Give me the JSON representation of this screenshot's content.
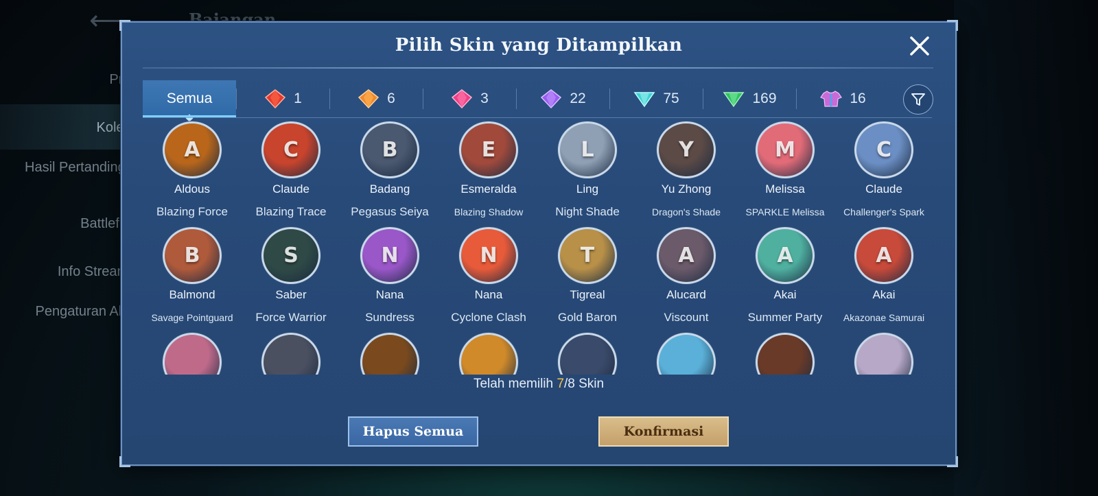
{
  "background": {
    "title": "Bajangan",
    "nav": [
      {
        "label": "Profil"
      },
      {
        "label": "Koleksi"
      },
      {
        "label": "Hasil Pertandingan"
      },
      {
        "label": "Battlefield"
      },
      {
        "label": "Info Streamer"
      },
      {
        "label": "Pengaturan Akun"
      }
    ]
  },
  "dialog": {
    "title": "Pilih Skin yang Ditampilkan",
    "tabs": [
      {
        "label": "Semua",
        "active": true
      },
      {
        "icon": "red-diamond-icon",
        "count": "1",
        "color": "#e23a2f"
      },
      {
        "icon": "orange-diamond-icon",
        "count": "6",
        "color": "#f08a2c"
      },
      {
        "icon": "pink-diamond-icon",
        "count": "3",
        "color": "#ef3f86"
      },
      {
        "icon": "purple-diamond-icon",
        "count": "22",
        "color": "#9b5bf0"
      },
      {
        "icon": "teal-diamond-icon",
        "count": "75",
        "color": "#3fd3d3"
      },
      {
        "icon": "green-diamond-icon",
        "count": "169",
        "color": "#2fc463"
      },
      {
        "icon": "shirt-icon",
        "count": "16",
        "color": "#c86ad8"
      }
    ],
    "skins": [
      {
        "hero": "Aldous",
        "skin": "Blazing Force",
        "initial": "A",
        "color": "#b9661b"
      },
      {
        "hero": "Claude",
        "skin": "Blazing Trace",
        "initial": "C",
        "color": "#c8442d"
      },
      {
        "hero": "Badang",
        "skin": "Pegasus Seiya",
        "initial": "B",
        "color": "#4a5870"
      },
      {
        "hero": "Esmeralda",
        "skin": "Blazing Shadow",
        "initial": "E",
        "color": "#a14a3c"
      },
      {
        "hero": "Ling",
        "skin": "Night Shade",
        "initial": "L",
        "color": "#8f9fb4"
      },
      {
        "hero": "Yu Zhong",
        "skin": "Dragon's Shade",
        "initial": "Y",
        "color": "#5b4a46"
      },
      {
        "hero": "Melissa",
        "skin": "SPARKLE Melissa",
        "initial": "M",
        "color": "#e26b78"
      },
      {
        "hero": "Claude",
        "skin": "Challenger's Spark",
        "initial": "C",
        "color": "#6b8fc4"
      },
      {
        "hero": "Balmond",
        "skin": "Savage Pointguard",
        "initial": "B",
        "color": "#b05a3c"
      },
      {
        "hero": "Saber",
        "skin": "Force Warrior",
        "initial": "S",
        "color": "#2f4a46"
      },
      {
        "hero": "Nana",
        "skin": "Sundress",
        "initial": "N",
        "color": "#9a57c8"
      },
      {
        "hero": "Nana",
        "skin": "Cyclone Clash",
        "initial": "N",
        "color": "#e85b3a"
      },
      {
        "hero": "Tigreal",
        "skin": "Gold Baron",
        "initial": "T",
        "color": "#b89048"
      },
      {
        "hero": "Alucard",
        "skin": "Viscount",
        "initial": "A",
        "color": "#6b5a6a"
      },
      {
        "hero": "Akai",
        "skin": "Summer Party",
        "initial": "A",
        "color": "#4fb0a0"
      },
      {
        "hero": "Akai",
        "skin": "Akazonae Samurai",
        "initial": "A",
        "color": "#c84a3a"
      },
      {
        "hero": "",
        "skin": "",
        "initial": "",
        "color": "#c06a8a"
      },
      {
        "hero": "",
        "skin": "",
        "initial": "",
        "color": "#4a5060"
      },
      {
        "hero": "",
        "skin": "",
        "initial": "",
        "color": "#7a4a1e"
      },
      {
        "hero": "",
        "skin": "",
        "initial": "",
        "color": "#d08a2a"
      },
      {
        "hero": "",
        "skin": "",
        "initial": "",
        "color": "#3a4a6a"
      },
      {
        "hero": "",
        "skin": "",
        "initial": "",
        "color": "#5ab0d8"
      },
      {
        "hero": "",
        "skin": "",
        "initial": "",
        "color": "#6a3a28"
      },
      {
        "hero": "",
        "skin": "",
        "initial": "",
        "color": "#b8a8c8"
      }
    ],
    "selection": {
      "prefix": "Telah memilih ",
      "selected": "7",
      "separator": "/",
      "total": "8",
      "suffix": " Skin"
    },
    "clear_label": "Hapus Semua",
    "confirm_label": "Konfirmasi"
  }
}
